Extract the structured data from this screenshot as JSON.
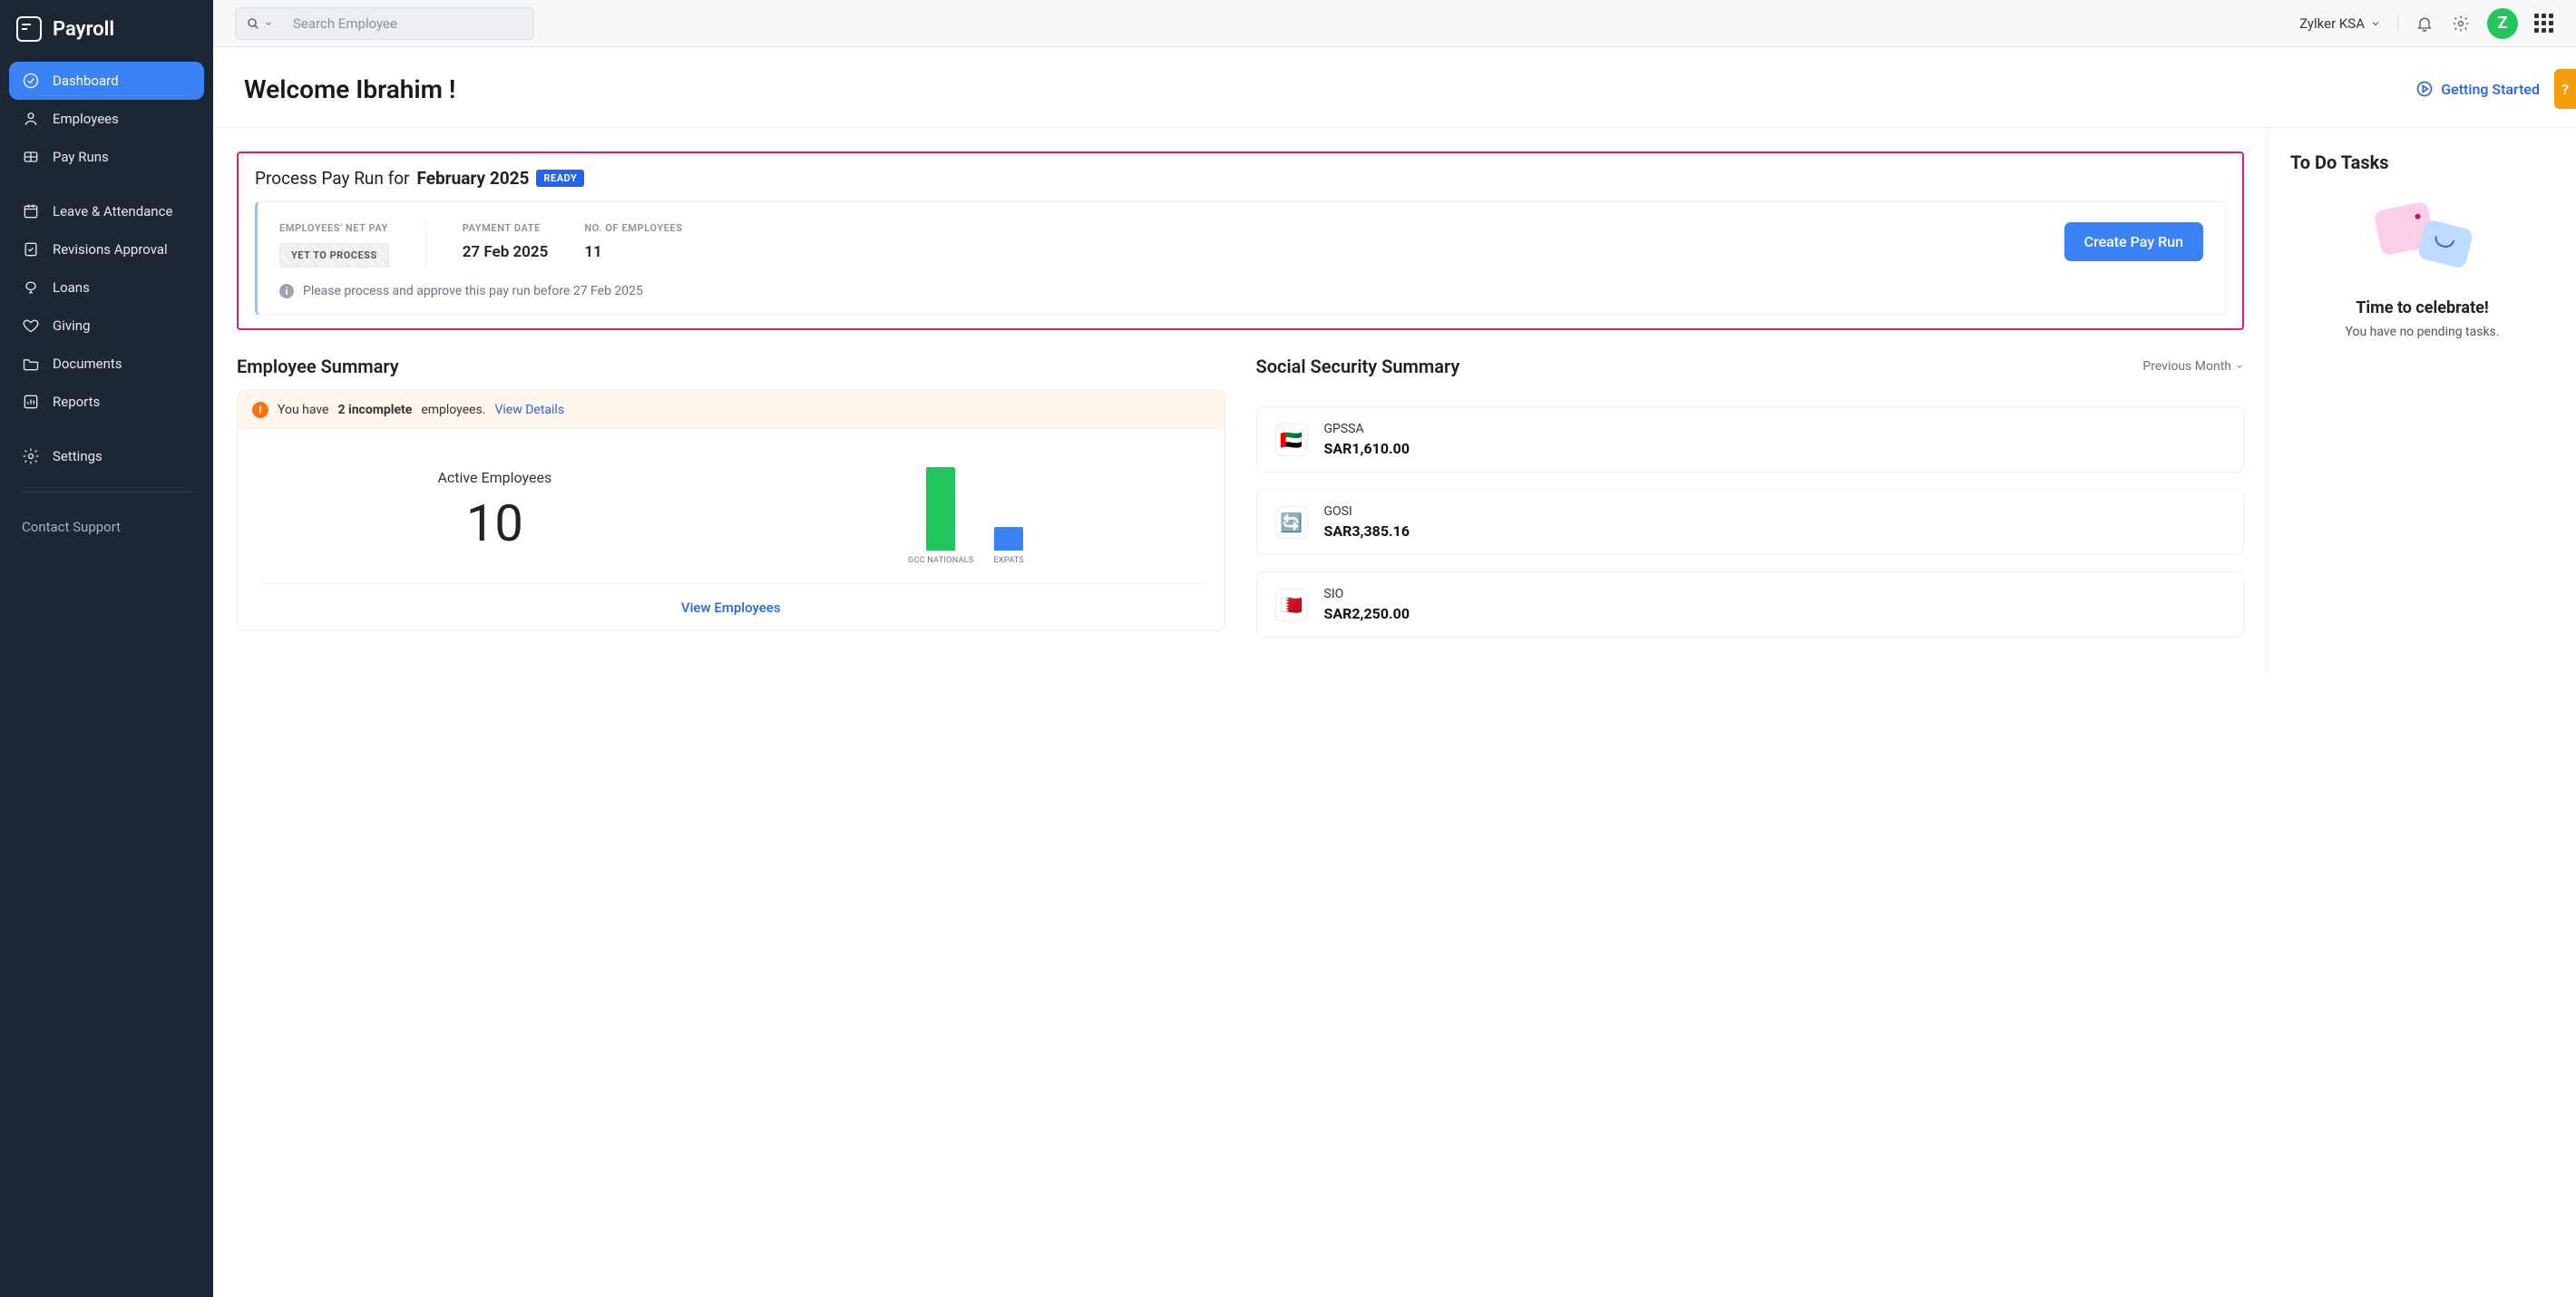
{
  "brand": "Payroll",
  "search_placeholder": "Search Employee",
  "org_name": "Zylker KSA",
  "avatar_initial": "Z",
  "sidebar": {
    "items": [
      {
        "label": "Dashboard"
      },
      {
        "label": "Employees"
      },
      {
        "label": "Pay Runs"
      },
      {
        "label": "Leave & Attendance"
      },
      {
        "label": "Revisions Approval"
      },
      {
        "label": "Loans"
      },
      {
        "label": "Giving"
      },
      {
        "label": "Documents"
      },
      {
        "label": "Reports"
      },
      {
        "label": "Settings"
      },
      {
        "label": "Contact Support"
      }
    ]
  },
  "welcome": "Welcome Ibrahim !",
  "getting_started": "Getting Started",
  "help_label": "?",
  "payrun": {
    "title_pre": "Process Pay Run for",
    "month": "February 2025",
    "ready_badge": "READY",
    "netpay_label": "EMPLOYEES' NET PAY",
    "netpay_value": "YET TO PROCESS",
    "date_label": "PAYMENT DATE",
    "date_value": "27 Feb 2025",
    "count_label": "NO. OF EMPLOYEES",
    "count_value": "11",
    "create_btn": "Create Pay Run",
    "note": "Please process and approve this pay run before 27 Feb 2025"
  },
  "emp_summary": {
    "title": "Employee Summary",
    "warn_pre": "You have",
    "warn_count": "2 incomplete",
    "warn_post": "employees.",
    "warn_link": "View Details",
    "active_label": "Active Employees",
    "active_count": "10",
    "bar1_label": "GCC NATIONALS",
    "bar2_label": "EXPATS",
    "view_link": "View Employees"
  },
  "ss_summary": {
    "title": "Social Security Summary",
    "period": "Previous Month",
    "items": [
      {
        "name": "GPSSA",
        "amount": "SAR1,610.00",
        "flag": "🇦🇪"
      },
      {
        "name": "GOSI",
        "amount": "SAR3,385.16",
        "flag": "🔄"
      },
      {
        "name": "SIO",
        "amount": "SAR2,250.00",
        "flag": "🇧🇭"
      }
    ]
  },
  "todo": {
    "title": "To Do Tasks",
    "head": "Time to celebrate!",
    "sub": "You have no pending tasks."
  },
  "chart_data": {
    "type": "bar",
    "title": "Active Employees by nationality",
    "categories": [
      "GCC NATIONALS",
      "EXPATS"
    ],
    "values": [
      8,
      2
    ],
    "ylim": [
      0,
      10
    ],
    "colors": [
      "#22c55e",
      "#3b82f6"
    ]
  }
}
